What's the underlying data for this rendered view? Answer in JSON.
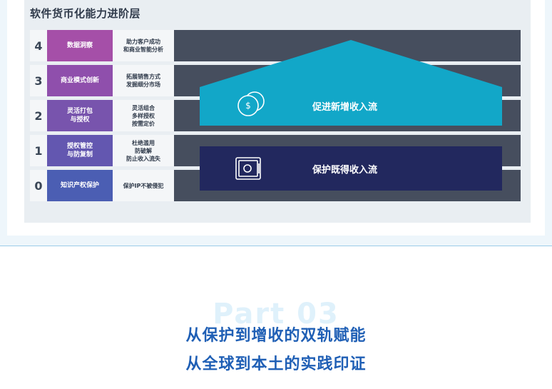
{
  "diagram_title": "软件货币化能力进阶层",
  "levels": [
    {
      "level": "4",
      "name": "数据洞察",
      "desc": "助力客户成功\n和商业智能分析",
      "color": "#a54fa8"
    },
    {
      "level": "3",
      "name": "商业模式创新",
      "desc": "拓展销售方式\n发掘细分市场",
      "color": "#8f4fac"
    },
    {
      "level": "2",
      "name": "灵活打包\n与授权",
      "desc": "灵活组合\n多样授权\n按需定价",
      "color": "#7854ad"
    },
    {
      "level": "1",
      "name": "授权管控\n与防复制",
      "desc": "杜绝滥用\n防破解\n防止收入流失",
      "color": "#6357b0"
    },
    {
      "level": "0",
      "name": "知识产权保护",
      "desc": "保护IP不被侵犯",
      "color": "#4b5eb3"
    }
  ],
  "bands": {
    "grow": {
      "label": "促进新增收入流",
      "icon": "dollar-coins-icon",
      "color": "#12a7c8"
    },
    "protect": {
      "label": "保护既得收入流",
      "icon": "safe-vault-icon",
      "color": "#22285e"
    }
  },
  "part_label": "Part 03",
  "headline_line1": "从保护到增收的双轨赋能",
  "headline_line2": "从全球到本土的实践印证"
}
